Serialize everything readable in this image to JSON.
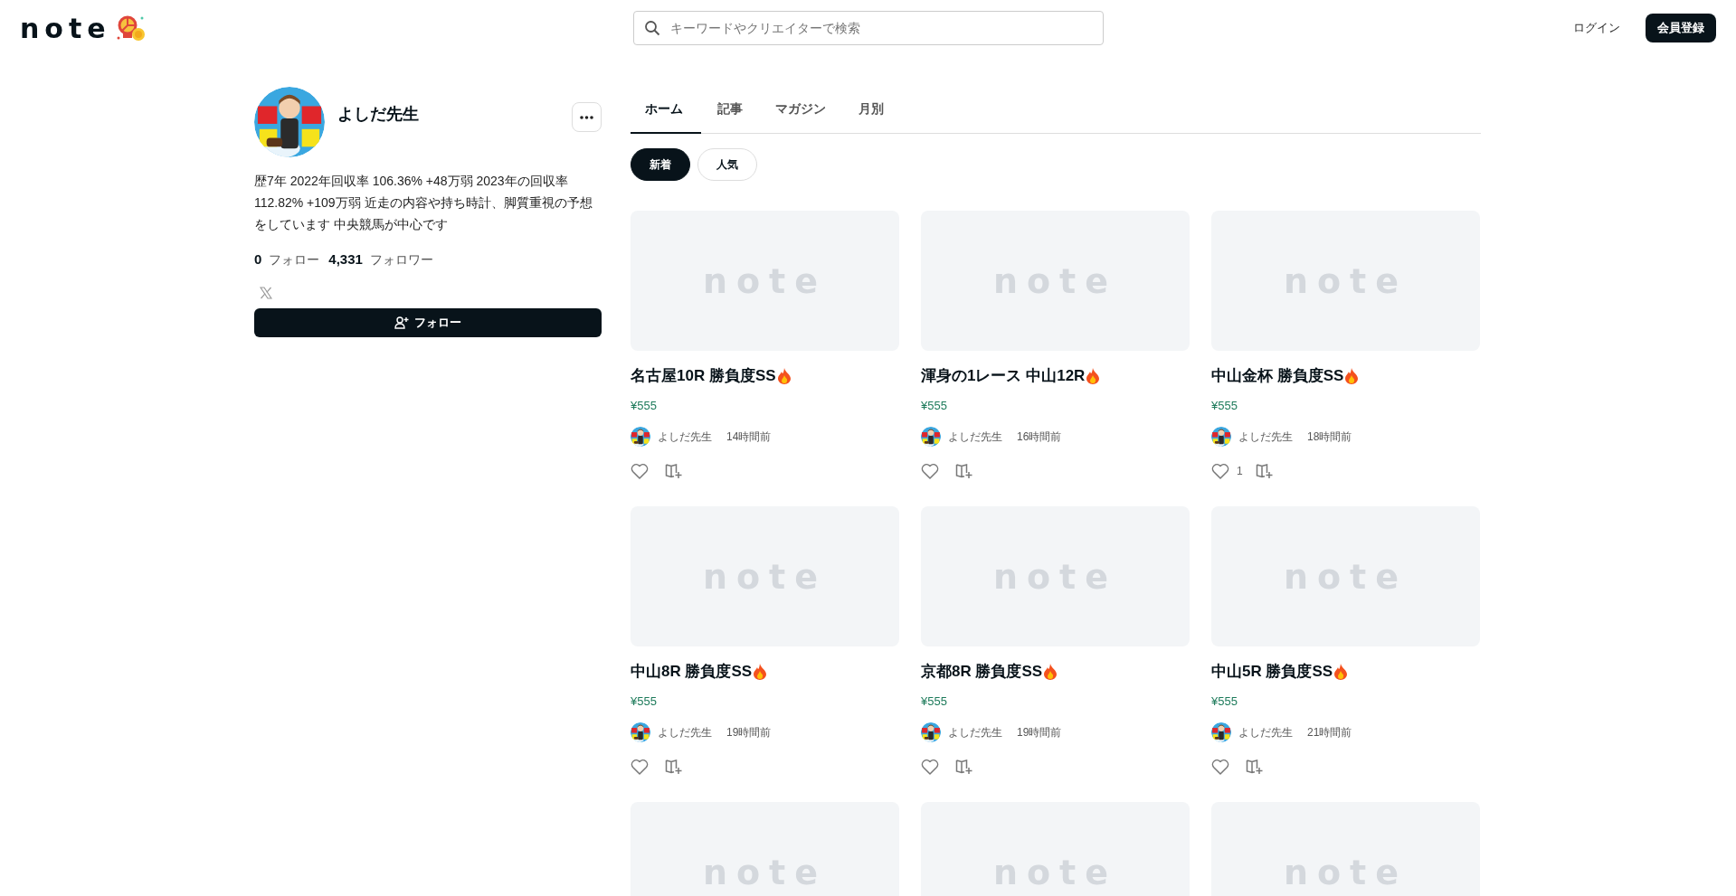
{
  "header": {
    "logo": "note",
    "search": {
      "placeholder": "キーワードやクリエイターで検索"
    },
    "login": "ログイン",
    "signup": "会員登録"
  },
  "profile": {
    "name": "よしだ先生",
    "bio": "歴7年 2022年回収率 106.36% +48万弱 2023年の回収率 112.82% +109万弱 近走の内容や持ち時計、脚質重視の予想をしています 中央競馬が中心です",
    "following_count": "0",
    "following_label": "フォロー",
    "followers_count": "4,331",
    "followers_label": "フォロワー",
    "follow_button": "フォロー"
  },
  "tabs": [
    {
      "label": "ホーム",
      "selected": true
    },
    {
      "label": "記事",
      "selected": false
    },
    {
      "label": "マガジン",
      "selected": false
    },
    {
      "label": "月別",
      "selected": false
    }
  ],
  "chips": [
    {
      "label": "新着",
      "selected": true
    },
    {
      "label": "人気",
      "selected": false
    }
  ],
  "cards": [
    {
      "kind": "full",
      "thumbnail_label": "note",
      "title": "名古屋10R 勝負度SS",
      "price": "¥555",
      "author": "よしだ先生",
      "time": "14時間前"
    },
    {
      "kind": "full",
      "thumbnail_label": "note",
      "title": "渾身の1レース 中山12R",
      "price": "¥555",
      "author": "よしだ先生",
      "time": "16時間前"
    },
    {
      "kind": "full",
      "thumbnail_label": "note",
      "title": "中山金杯 勝負度SS",
      "price": "¥555",
      "author": "よしだ先生",
      "time": "18時間前",
      "likes": "1"
    },
    {
      "kind": "full",
      "thumbnail_label": "note",
      "title": "中山8R 勝負度SS",
      "price": "¥555",
      "author": "よしだ先生",
      "time": "19時間前"
    },
    {
      "kind": "full",
      "thumbnail_label": "note",
      "title": "京都8R 勝負度SS",
      "price": "¥555",
      "author": "よしだ先生",
      "time": "19時間前"
    },
    {
      "kind": "full",
      "thumbnail_label": "note",
      "title": "中山5R 勝負度SS",
      "price": "¥555",
      "author": "よしだ先生",
      "time": "21時間前"
    },
    {
      "kind": "thumbnail",
      "thumbnail_label": "note"
    },
    {
      "kind": "thumbnail",
      "thumbnail_label": "note"
    },
    {
      "kind": "thumbnail",
      "thumbnail_label": "note"
    }
  ]
}
